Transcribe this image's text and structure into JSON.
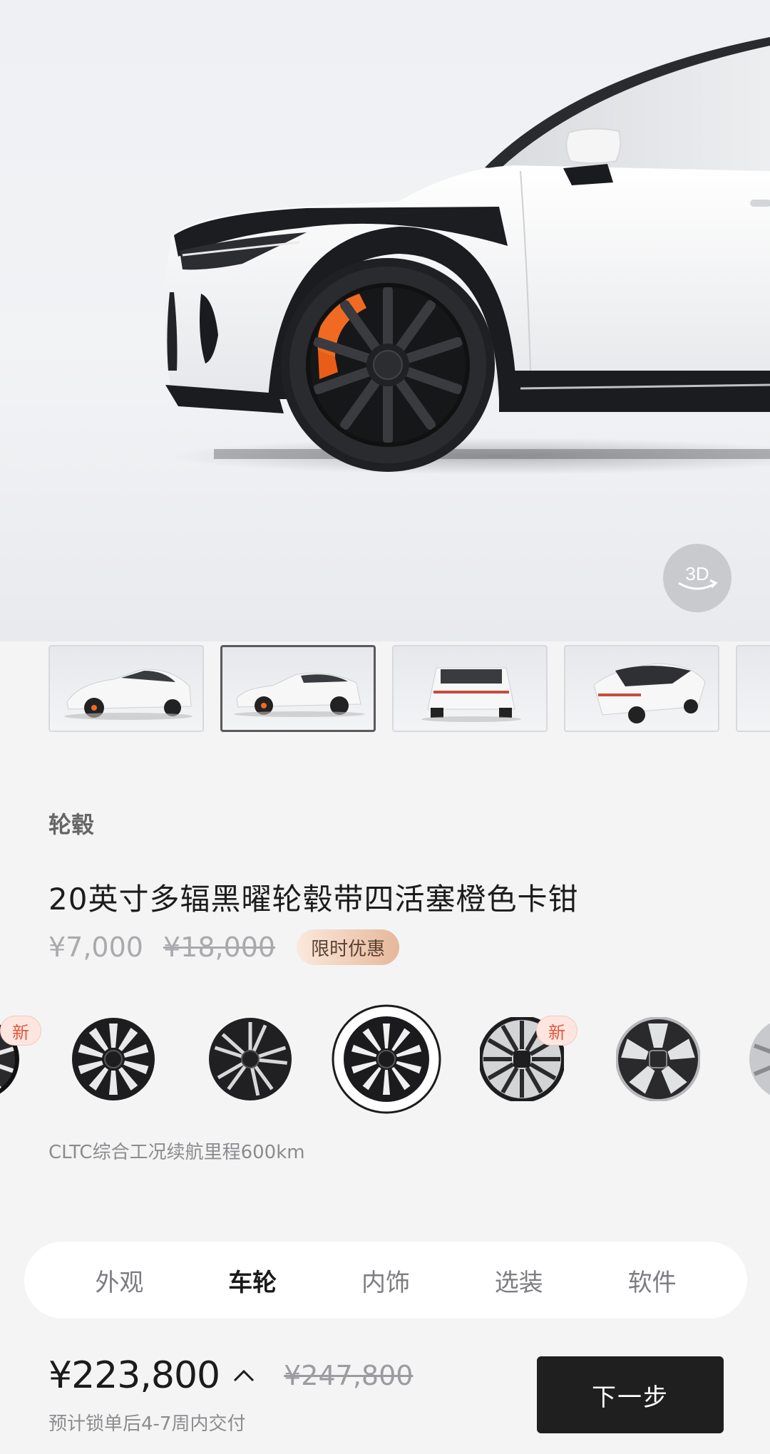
{
  "hero": {
    "view_3d_label": "3D",
    "thumbnails": [
      {
        "name": "front-three-quarter"
      },
      {
        "name": "side",
        "selected": true
      },
      {
        "name": "rear"
      },
      {
        "name": "rear-three-quarter-top"
      },
      {
        "name": "partial"
      }
    ]
  },
  "config": {
    "section_label": "轮毂",
    "product_title": "20英寸多辐黑曜轮毂带四活塞橙色卡钳",
    "price_current": "¥7,000",
    "price_original": "¥18,000",
    "promo_badge": "限时优惠",
    "new_badge": "新",
    "range_note": "CLTC综合工况续航里程600km",
    "wheels": [
      {
        "name": "wheel-option-1",
        "new": true
      },
      {
        "name": "wheel-option-2"
      },
      {
        "name": "wheel-option-3"
      },
      {
        "name": "wheel-option-4",
        "selected": true
      },
      {
        "name": "wheel-option-5",
        "new": true
      },
      {
        "name": "wheel-option-6"
      },
      {
        "name": "wheel-option-7"
      }
    ]
  },
  "tabs": [
    {
      "label": "外观"
    },
    {
      "label": "车轮",
      "active": true
    },
    {
      "label": "内饰"
    },
    {
      "label": "选装"
    },
    {
      "label": "软件"
    }
  ],
  "footer": {
    "total_price": "¥223,800",
    "total_original": "¥247,800",
    "delivery_note": "预计锁单后4-7周内交付",
    "next_button": "下一步"
  },
  "colors": {
    "caliper": "#f06a22",
    "accent_dark": "#1f1f1f",
    "new_badge_text": "#e2583d",
    "promo_gradient_start": "#fbe9dc",
    "promo_gradient_end": "#e6b89b"
  }
}
